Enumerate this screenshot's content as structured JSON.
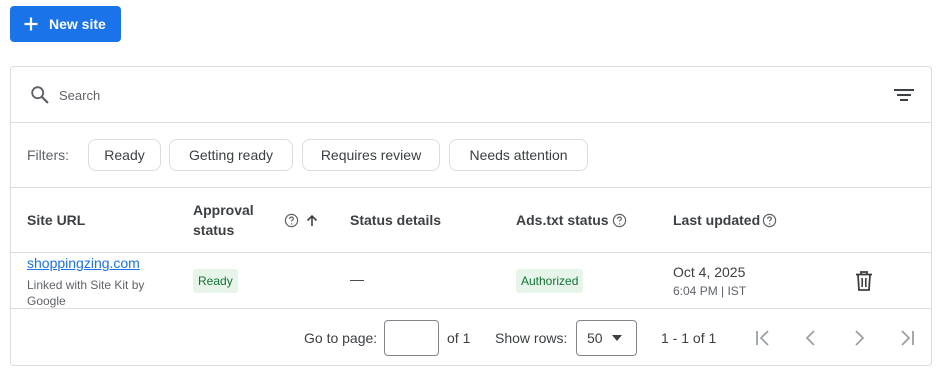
{
  "toolbar": {
    "new_site_label": "New site"
  },
  "search": {
    "placeholder": "Search"
  },
  "filters": {
    "label": "Filters:",
    "chips": [
      "Ready",
      "Getting ready",
      "Requires review",
      "Needs attention"
    ]
  },
  "table": {
    "columns": {
      "site_url": "Site URL",
      "approval_status_line1": "Approval",
      "approval_status_line2": "status",
      "status_details": "Status details",
      "ads_txt_status": "Ads.txt status",
      "last_updated": "Last updated"
    },
    "rows": [
      {
        "site_url": "shoppingzing.com",
        "site_note": "Linked with Site Kit by Google",
        "approval_status": "Ready",
        "status_details": "—",
        "ads_txt_status": "Authorized",
        "last_updated_date": "Oct 4, 2025",
        "last_updated_time": "6:04 PM | IST"
      }
    ]
  },
  "pagination": {
    "go_to_page_label": "Go to page:",
    "page_value": "",
    "of_pages": "of 1",
    "show_rows_label": "Show rows:",
    "rows_per_page": "50",
    "range_text": "1 - 1 of 1"
  },
  "colors": {
    "accent": "#1a73e8",
    "ready_badge_bg": "#e6f4ea",
    "ready_badge_text": "#137333",
    "border": "#dadce0"
  },
  "icons": [
    "plus-icon",
    "search-icon",
    "filter-list-icon",
    "help-icon",
    "arrow-upward-icon",
    "trash-icon",
    "first-page-icon",
    "chevron-left-icon",
    "chevron-right-icon",
    "last-page-icon",
    "dropdown-arrow-icon"
  ]
}
